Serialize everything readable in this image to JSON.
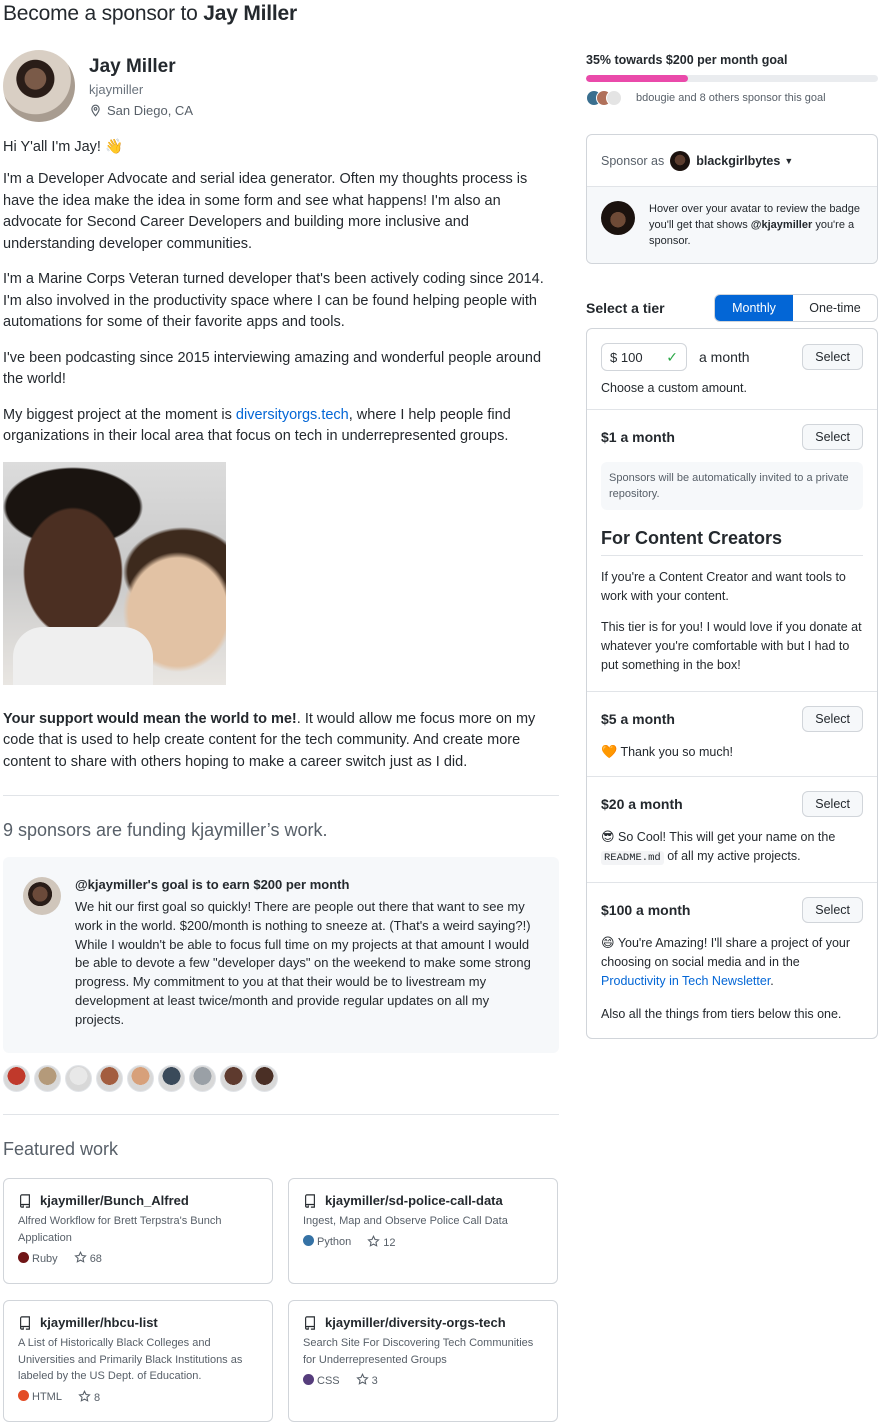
{
  "page": {
    "title_prefix": "Become a sponsor to ",
    "title_name": "Jay Miller"
  },
  "profile": {
    "name": "Jay Miller",
    "login": "kjaymiller",
    "location": "San Diego, CA",
    "location_icon": "location-pin-icon"
  },
  "bio": {
    "greeting": "Hi Y'all I'm Jay! 👋",
    "p1": "I'm a Developer Advocate and serial idea generator. Often my thoughts process is have the idea make the idea in some form and see what happens! I'm also an advocate for Second Career Developers and building more inclusive and understanding developer communities.",
    "p2": "I'm a Marine Corps Veteran turned developer that's been actively coding since 2014. I'm also involved in the productivity space where I can be found helping people with automations for some of their favorite apps and tools.",
    "p3": "I've been podcasting since 2015 interviewing amazing and wonderful people around the world!",
    "p4_before": "My biggest project at the moment is ",
    "p4_link": "diversityorgs.tech",
    "p4_after": ", where I help people find organizations in their local area that focus on tech in underrepresented groups.",
    "support_bold": "Your support would mean the world to me!",
    "support_rest": ". It would allow me focus more on my code that is used to help create content for the tech community. And create more content to share with others hoping to make a career switch just as I did."
  },
  "funding": {
    "title": "9 sponsors are funding kjaymiller’s work.",
    "goal_heading": "@kjaymiller's goal is to earn $200 per month",
    "goal_text": "We hit our first goal so quickly! There are people out there that want to see my work in the world. $200/month is nothing to sneeze at. (That's a weird saying?!) While I wouldn't be able to focus full time on my projects at that amount I would be able to devote a few \"developer days\" on the weekend to make some strong progress. My commitment to you at that their would be to livestream my development at least twice/month and provide regular updates on all my projects.",
    "sponsor_avatar_colors": [
      "#c0392b",
      "#b49a7a",
      "#e8e8e8",
      "#a35d3f",
      "#d7a07a",
      "#3a4a5a",
      "#9aa0a6",
      "#5e3a2e",
      "#4a2f25"
    ]
  },
  "featured": {
    "title": "Featured work",
    "repos": [
      {
        "name": "kjaymiller/Bunch_Alfred",
        "desc": "Alfred Workflow for Brett Terpstra's Bunch Application",
        "lang": "Ruby",
        "lang_color": "#701516",
        "stars": "68"
      },
      {
        "name": "kjaymiller/sd-police-call-data",
        "desc": "Ingest, Map and Observe Police Call Data",
        "lang": "Python",
        "lang_color": "#3572A5",
        "stars": "12"
      },
      {
        "name": "kjaymiller/hbcu-list",
        "desc": "A List of Historically Black Colleges and Universities and Primarily Black Institutions as labeled by the US Dept. of Education.",
        "lang": "HTML",
        "lang_color": "#e34c26",
        "stars": "8"
      },
      {
        "name": "kjaymiller/diversity-orgs-tech",
        "desc": "Search Site For Discovering Tech Communities for Underrepresented Groups",
        "lang": "CSS",
        "lang_color": "#563d7c",
        "stars": "3"
      }
    ]
  },
  "goal": {
    "label": "35% towards $200 per month goal",
    "percent": 35,
    "sponsors_text": "bdougie and 8 others sponsor this goal"
  },
  "sponsor_as": {
    "label": "Sponsor as",
    "account": "blackgirlbytes",
    "hint_before": "Hover over your avatar to review the badge you'll get that shows ",
    "hint_handle": "@kjaymiller",
    "hint_after": " you're a sponsor."
  },
  "tiers_header": {
    "label": "Select a tier",
    "monthly": "Monthly",
    "onetime": "One-time"
  },
  "custom_tier": {
    "currency": "$",
    "amount": "100",
    "per": "a month",
    "select": "Select",
    "note": "Choose a custom amount."
  },
  "tiers": [
    {
      "price": "$1 a month",
      "select": "Select",
      "note": "Sponsors will be automatically invited to a private repository.",
      "heading": "For Content Creators",
      "p1": "If you're a Content Creator and want tools to work with your content.",
      "p2": "This tier is for you! I would love if you donate at whatever you're comfortable with but I had to put something in the box!"
    },
    {
      "price": "$5 a month",
      "select": "Select",
      "emoji": "🧡",
      "desc": "Thank you so much!"
    },
    {
      "price": "$20 a month",
      "select": "Select",
      "emoji": "😎",
      "desc_before": "So Cool! This will get your name on the ",
      "desc_code": "README.md",
      "desc_after": " of all my active projects."
    },
    {
      "price": "$100 a month",
      "select": "Select",
      "emoji": "😄",
      "desc_before": "You're Amazing! I'll share a project of your choosing on social media and in the ",
      "desc_link": "Productivity in Tech Newsletter",
      "desc_after": ".",
      "desc2": "Also all the things from tiers below this one."
    }
  ]
}
